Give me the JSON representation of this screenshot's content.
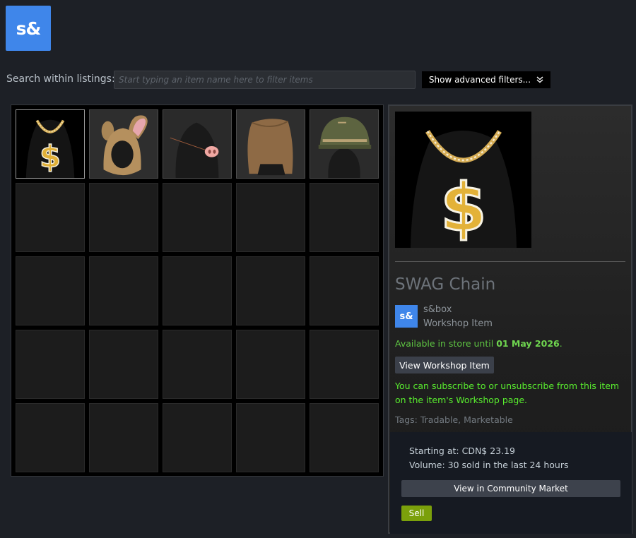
{
  "app": {
    "logo_text": "s&",
    "brand_color": "#3f86ea"
  },
  "search": {
    "label": "Search within listings:",
    "placeholder": "Start typing an item name here to filter items",
    "value": "",
    "advanced_filters_label": "Show advanced filters..."
  },
  "inventory": {
    "columns": 5,
    "rows": 5,
    "items": [
      {
        "icon": "swag-chain-icon",
        "selected": true
      },
      {
        "icon": "bunny-hood-icon",
        "selected": false
      },
      {
        "icon": "pig-nose-icon",
        "selected": false
      },
      {
        "icon": "sack-hood-icon",
        "selected": false
      },
      {
        "icon": "army-helmet-icon",
        "selected": false
      }
    ]
  },
  "detail": {
    "item_name": "SWAG Chain",
    "game_icon_text": "s&",
    "game_name": "s&box",
    "item_type": "Workshop Item",
    "availability_prefix": "Available in store until",
    "availability_date": "01 May 2026",
    "availability_suffix": ".",
    "view_workshop_label": "View Workshop Item",
    "subscribe_note": "You can subscribe to or unsubscribe from this item on the item's Workshop page.",
    "tags": "Tags: Tradable, Marketable",
    "market": {
      "starting_at": "Starting at: CDN$ 23.19",
      "volume": "Volume: 30 sold in the last 24 hours",
      "view_market_label": "View in Community Market",
      "sell_label": "Sell"
    }
  }
}
